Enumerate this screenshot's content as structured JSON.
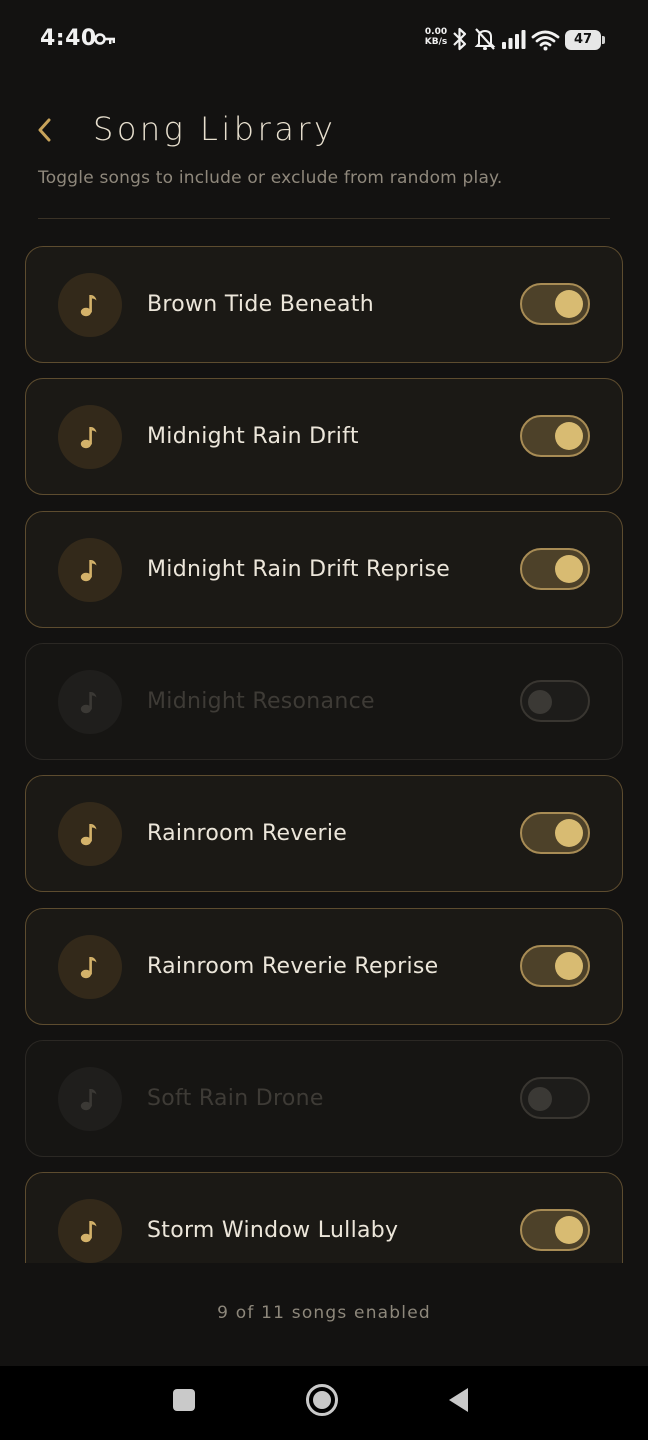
{
  "status_bar": {
    "time": "4:40",
    "net_speed_value": "0.00",
    "net_speed_unit": "KB/s",
    "battery": "47",
    "icons": [
      "key-icon",
      "bluetooth-icon",
      "bell-off-icon",
      "signal-icon",
      "wifi-icon",
      "battery-icon"
    ]
  },
  "header": {
    "back_icon": "chevron-left-icon",
    "title": "Song Library",
    "subtitle": "Toggle songs to include or exclude from random play."
  },
  "songs": [
    {
      "title": "Brown Tide Beneath",
      "enabled": true
    },
    {
      "title": "Midnight Rain Drift",
      "enabled": true
    },
    {
      "title": "Midnight Rain Drift Reprise",
      "enabled": true
    },
    {
      "title": "Midnight Resonance",
      "enabled": false
    },
    {
      "title": "Rainroom Reverie",
      "enabled": true
    },
    {
      "title": "Rainroom Reverie Reprise",
      "enabled": true
    },
    {
      "title": "Soft Rain Drone",
      "enabled": false
    },
    {
      "title": "Storm Window Lullaby",
      "enabled": true
    }
  ],
  "footer": {
    "count_text": "9 of 11 songs enabled"
  },
  "colors": {
    "background": "#131211",
    "accent": "#d8bb72",
    "card_border": "#5d4c2f"
  },
  "nav_bar": {
    "icons": [
      "recents-square-icon",
      "home-circle-icon",
      "back-triangle-icon"
    ]
  }
}
